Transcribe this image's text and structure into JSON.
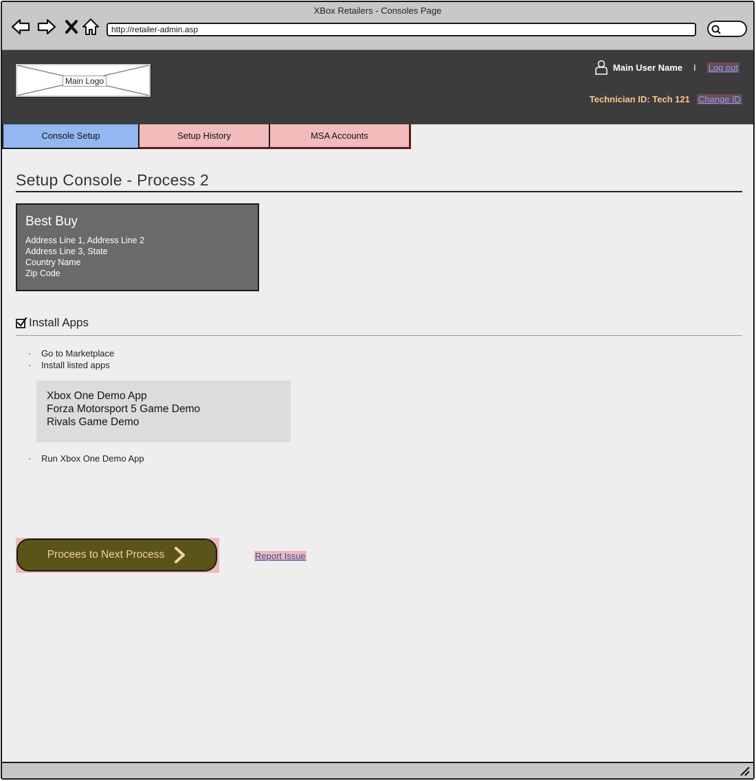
{
  "browser": {
    "title": "XBox Retailers - Consoles Page",
    "url": "http://retailer-admin.asp",
    "icons": [
      "back-arrow-icon",
      "forward-arrow-icon",
      "close-x-icon",
      "home-icon",
      "search-icon"
    ]
  },
  "header": {
    "logo_label": "Main Logo",
    "user_name": "Main User Name",
    "separator": "I",
    "logout_label": "Log out",
    "technician_text": "Technician ID: Tech 121",
    "change_id_label": "Change ID"
  },
  "tabs": [
    {
      "label": "Console Setup",
      "active": true
    },
    {
      "label": "Setup History",
      "active": false
    },
    {
      "label": "MSA Accounts",
      "active": false
    }
  ],
  "page": {
    "title": "Setup Console - Process 2"
  },
  "store": {
    "name": "Best Buy",
    "address_lines": [
      "Address Line 1, Address Line 2",
      "Address Line 3, State",
      "Country Name",
      "Zip Code"
    ]
  },
  "install_section": {
    "title": "Install Apps",
    "checked": true,
    "bullets": [
      "Go to Marketplace",
      "Install listed apps"
    ],
    "apps": [
      "Xbox One Demo App",
      "Forza Motorsport 5 Game Demo",
      "Rivals Game Demo"
    ],
    "final_bullet": "Run Xbox One Demo App",
    "bullet_char": "·"
  },
  "actions": {
    "proceed_label": "Procees to Next Process",
    "report_label": "Report Issue"
  },
  "colors": {
    "header_bg": "#3c3c3c",
    "active_tab": "#93b7f0",
    "inactive_tab": "#f2bcbc",
    "proceed_bg": "#5b5418",
    "store_card_bg": "#6a6a6a"
  }
}
